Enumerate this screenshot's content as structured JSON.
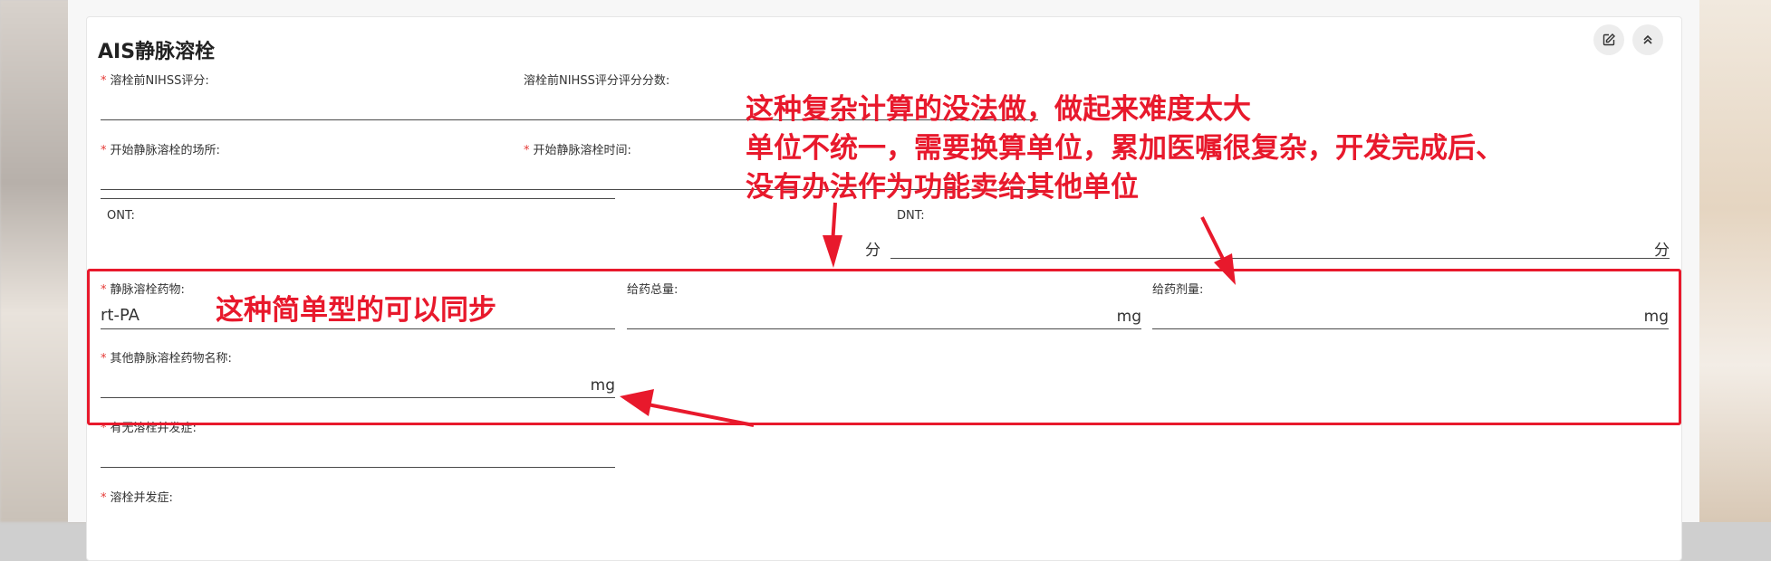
{
  "card": {
    "title": "AIS静脉溶栓",
    "edit_icon": "edit-icon",
    "collapse_icon": "chevrons-up-icon"
  },
  "fields": {
    "pre_nihss": {
      "label": "溶栓前NIHSS评分:",
      "required": true,
      "value": ""
    },
    "pre_nihss_score": {
      "label": "溶栓前NIHSS评分评分分数:",
      "required": false,
      "value": ""
    },
    "place": {
      "label": "开始静脉溶栓的场所:",
      "required": true,
      "value": ""
    },
    "start_time": {
      "label": "开始静脉溶栓时间:",
      "required": true,
      "value": ""
    },
    "ont": {
      "label": "ONT:",
      "required": false,
      "value": "",
      "unit": "分"
    },
    "dnt": {
      "label": "DNT:",
      "required": false,
      "value": "",
      "unit": "分"
    },
    "drug": {
      "label": "静脉溶栓药物:",
      "required": true,
      "value": "rt-PA"
    },
    "total_dose": {
      "label": "给药总量:",
      "required": false,
      "value": "",
      "unit": "mg"
    },
    "dose": {
      "label": "给药剂量:",
      "required": false,
      "value": "",
      "unit": "mg"
    },
    "other_drug": {
      "label": "其他静脉溶栓药物名称:",
      "required": true,
      "value": "",
      "unit": "mg"
    },
    "complication_flag": {
      "label": "有无溶栓并发症:",
      "required": true,
      "value": ""
    },
    "complication": {
      "label": "溶栓并发症:",
      "required": true,
      "value": ""
    }
  },
  "annotations": {
    "main_lines": [
      "这种复杂计算的没法做，做起来难度太大",
      "单位不统一，需要换算单位，累加医嘱很复杂，开发完成后、",
      "没有办法作为功能卖给其他单位"
    ],
    "simple": "这种简单型的可以同步",
    "color": "#e8192c"
  }
}
